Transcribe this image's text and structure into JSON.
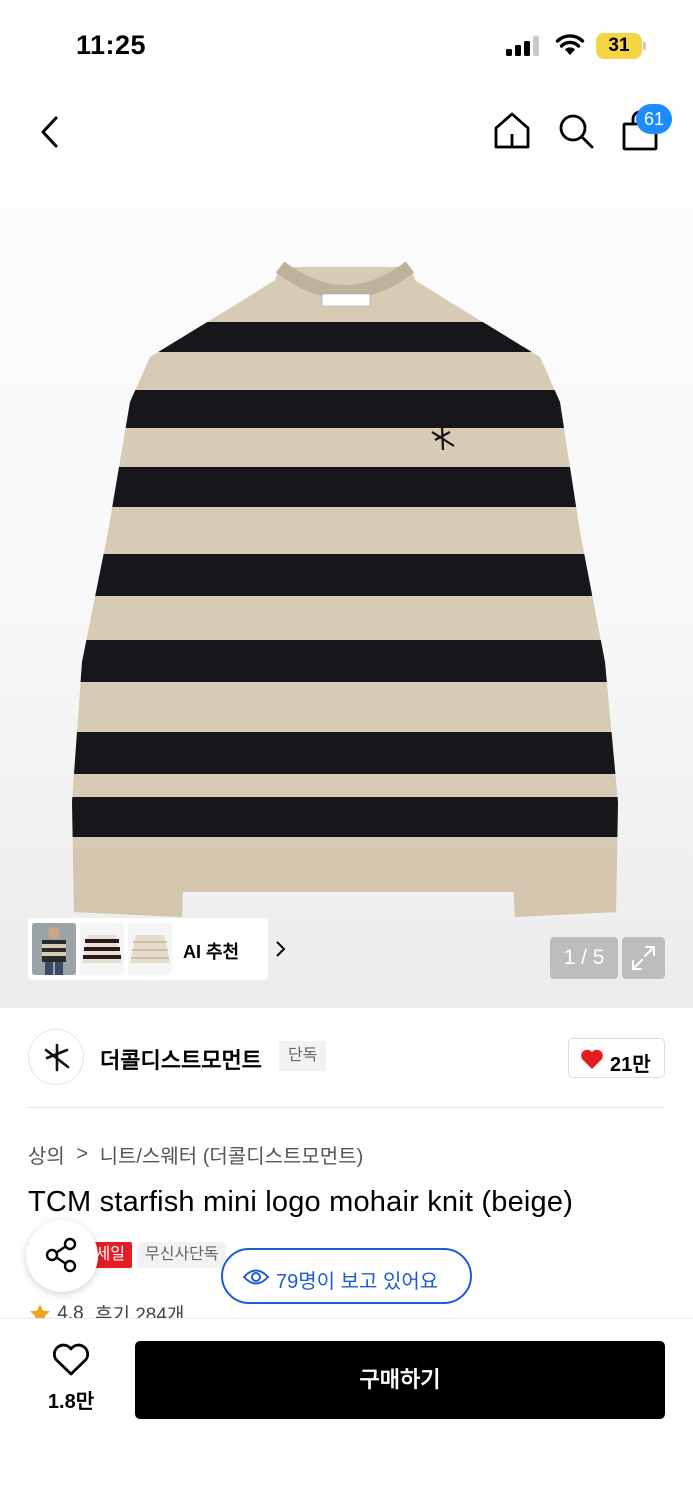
{
  "status_bar": {
    "time": "11:25",
    "battery": "31"
  },
  "nav": {
    "cart_count": "61"
  },
  "gallery": {
    "ai_label": "AI 추천",
    "pager": "1 / 5"
  },
  "brand": {
    "name": "더콜디스트모먼트",
    "exclusive_tag": "단독",
    "likes": "21만"
  },
  "breadcrumb": {
    "category": "상의",
    "separator": ">",
    "subcategory": "니트/스웨터 (더콜디스트모먼트)"
  },
  "product": {
    "title": "TCM starfish mini logo mohair knit (beige)",
    "sale_tag": "세일",
    "excl_tag": "무신사단독",
    "viewers": "79명이 보고 있어요",
    "rating": "4.8",
    "reviews": "후기 284개"
  },
  "bottom": {
    "wish_count": "1.8만",
    "buy_label": "구매하기"
  },
  "colors": {
    "accent_blue": "#1f5bd6",
    "sale_red": "#e51c23",
    "heart_red": "#e51c23",
    "badge_blue": "#1e8bff"
  }
}
